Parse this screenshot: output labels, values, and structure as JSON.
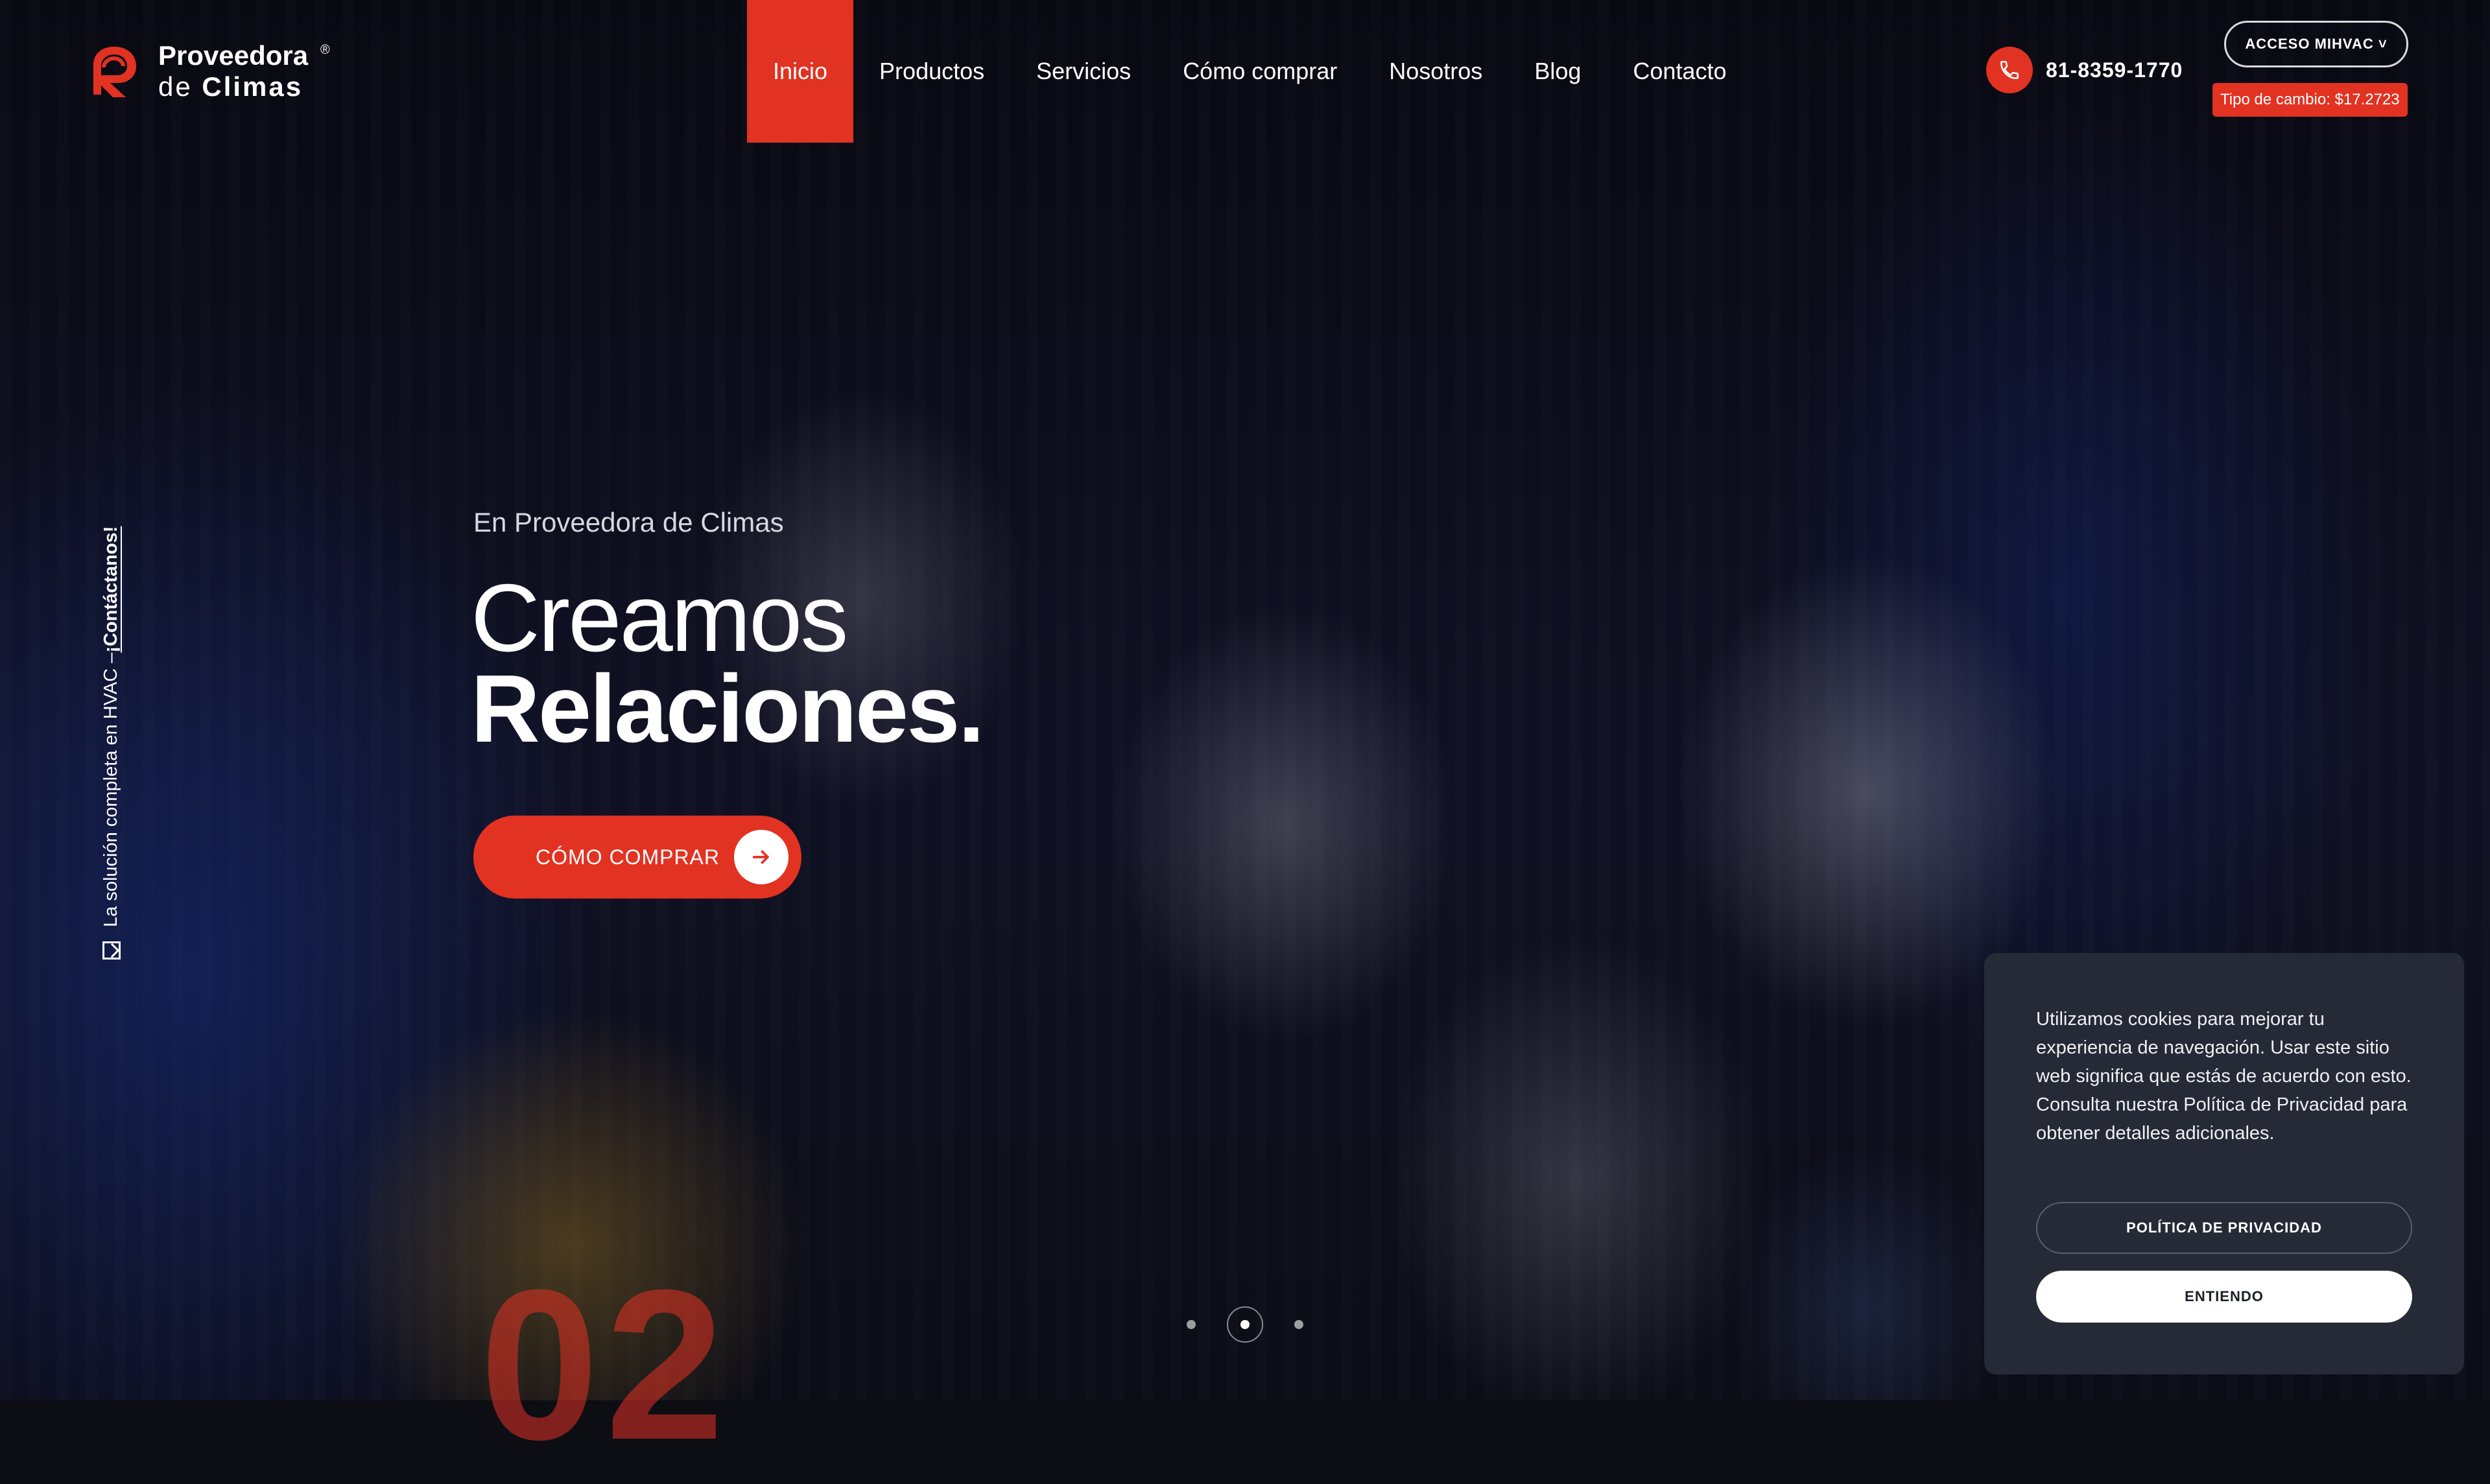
{
  "brand": {
    "name_line1": "Proveedora",
    "name_line2_prefix": "de",
    "name_line2_bold": "Climas",
    "registered": "®",
    "accent": "#e23222"
  },
  "nav": {
    "items": [
      {
        "label": "Inicio",
        "active": true
      },
      {
        "label": "Productos",
        "active": false
      },
      {
        "label": "Servicios",
        "active": false
      },
      {
        "label": "Cómo comprar",
        "active": false
      },
      {
        "label": "Nosotros",
        "active": false
      },
      {
        "label": "Blog",
        "active": false
      },
      {
        "label": "Contacto",
        "active": false
      }
    ]
  },
  "header": {
    "phone_icon": "phone-icon",
    "phone": "81-8359-1770",
    "access_label": "ACCESO MIHVAC ˅",
    "exchange_rate": "Tipo de cambio: $17.2723"
  },
  "side": {
    "text": "La solución completa en HVAC – ",
    "link": "¡Contáctanos!",
    "icon": "envelope-icon"
  },
  "hero": {
    "eyebrow": "En Proveedora de Climas",
    "line1": "Creamos",
    "line2": "Relaciones.",
    "cta_label": "CÓMO COMPRAR",
    "cta_icon": "arrow-right-icon",
    "slide_number": "02",
    "slides": {
      "count": 3,
      "active_index": 1
    }
  },
  "cookie": {
    "text": "Utilizamos cookies para mejorar tu experiencia de navegación. Usar este sitio web significa que estás de acuerdo con esto. Consulta nuestra Política de Privacidad para obtener detalles adicionales.",
    "privacy_label": "POLÍTICA DE PRIVACIDAD",
    "accept_label": "ENTIENDO"
  }
}
